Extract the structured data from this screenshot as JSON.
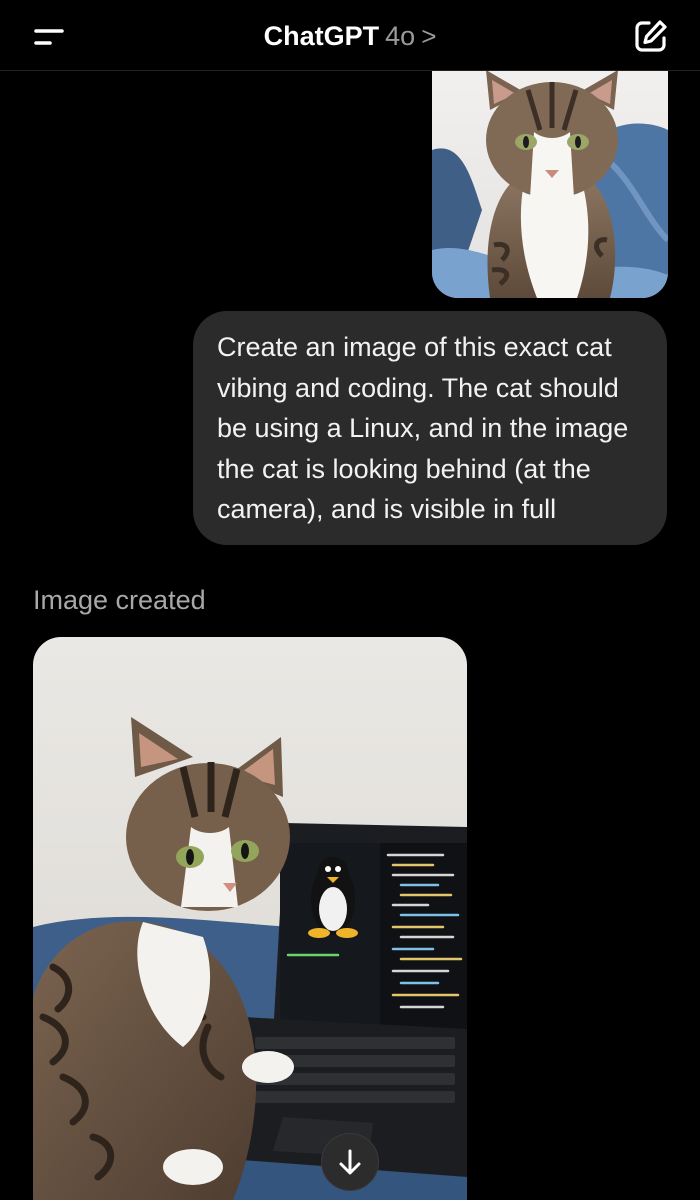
{
  "header": {
    "title": "ChatGPT",
    "model": "4o",
    "chevron": ">",
    "menu_icon": "sidebar-menu-icon",
    "new_chat_icon": "compose-icon"
  },
  "conversation": {
    "user_image": {
      "subject": "tabby cat with white chest sitting on blue blanket"
    },
    "user_message": {
      "lines": [
        "Create an image of this exact cat",
        "vibing and coding. The cat should",
        "be using a Linux, and in the image",
        "the cat is looking behind (at the",
        "camera), and is visible in full"
      ]
    },
    "assistant": {
      "status_label": "Image created",
      "generated_image": {
        "subject": "tabby cat sitting next to laptop showing Linux penguin and code"
      }
    }
  },
  "scroll_button": {
    "icon": "arrow-down-icon"
  },
  "colors": {
    "background": "#000000",
    "bubble": "#2b2b2b",
    "muted_text": "#a8a8a8"
  }
}
